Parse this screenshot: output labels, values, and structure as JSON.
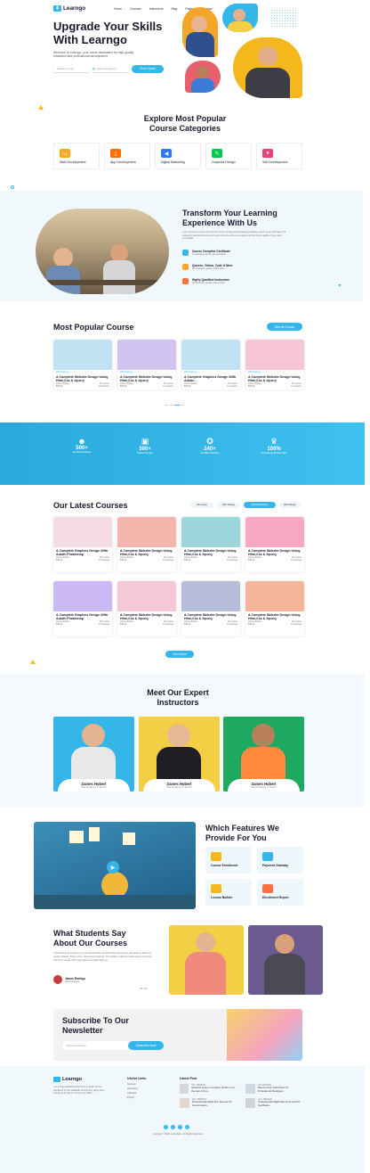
{
  "brand": {
    "name": "Learngo",
    "accent": "#35b6e8",
    "highlight": "#f9a825"
  },
  "nav": {
    "items": [
      "Home",
      "Courses",
      "Instructors",
      "Blog",
      "Pages",
      "Contact"
    ]
  },
  "hero": {
    "title_line1": "Upgrade Your Skills",
    "title_line2": "With Learngo",
    "subtitle": "Welcome to Learngo, your online destination for high-quality education and professional development",
    "search_placeholder": "Search course",
    "category_placeholder": "Select Category",
    "find_button": "Find Course"
  },
  "categories": {
    "title_line1": "Explore Most Popular",
    "title_line2": "Course Categories",
    "items": [
      {
        "label": "Web Development",
        "color": "#f9a825",
        "icon": "monitor-icon"
      },
      {
        "label": "App Development",
        "color": "#ff6d00",
        "icon": "phone-icon"
      },
      {
        "label": "Digital Marketing",
        "color": "#2979ff",
        "icon": "megaphone-icon"
      },
      {
        "label": "Graphics Design",
        "color": "#00c853",
        "icon": "pen-icon"
      },
      {
        "label": "Self Development",
        "color": "#ec407a",
        "icon": "person-icon"
      }
    ]
  },
  "transform": {
    "title_line1": "Transform Your Learning",
    "title_line2": "Experience With Us",
    "body": "Lorem ipsum is simply dummy text of the printing and typesetting industry. Lorem ipsum has been the industry's standard dummy text ever since the when an unknown printer took a galley of type and scrambled.",
    "features": [
      {
        "title": "Course Complete Certificate",
        "desc": "Completing course get certificate",
        "color": "#35b6e8"
      },
      {
        "title": "Quizzes, Videos, Code & More",
        "desc": "All Instructor quality online store",
        "color": "#f9a825"
      },
      {
        "title": "Highly Qualified Instructors",
        "desc": "All Instructor quality online store",
        "color": "#ff7043"
      }
    ]
  },
  "popular": {
    "title": "Most Popular Course",
    "see_all": "See All Course",
    "cards": [
      {
        "tag": "Web Design",
        "title": "A Complete Website Design Using Html,Css & Jquery",
        "author": "James Robert",
        "lessons": "30 Lesson",
        "price": "$35.00",
        "students": "26 students",
        "thumb": "#bfe3f3"
      },
      {
        "tag": "Web Design",
        "title": "A Complete Website Design Using Html,Css & Jquery",
        "author": "James Robert",
        "lessons": "30 Lesson",
        "price": "$35.00",
        "students": "11 students",
        "thumb": "#cfc3f0"
      },
      {
        "tag": "Web Design",
        "title": "A Complete Graphics Design With Adobe...",
        "author": "James Robert",
        "lessons": "30 Lesson",
        "price": "$35.00",
        "students": "11 students",
        "thumb": "#bfe3f3"
      },
      {
        "tag": "Web Design",
        "title": "A Complete Website Design Using Html,Css & Jquery",
        "author": "James Robert",
        "lessons": "30 Lesson",
        "price": "$35.00",
        "students": "11 students",
        "thumb": "#f7c6d6"
      }
    ]
  },
  "stats": [
    {
      "num": "500+",
      "label": "Enrolled Students",
      "icon": "students-icon"
    },
    {
      "num": "300+",
      "label": "Online Courses",
      "icon": "board-icon"
    },
    {
      "num": "240+",
      "label": "Certified Teachers",
      "icon": "certificate-icon"
    },
    {
      "num": "100%",
      "label": "Success & Comfort Rate",
      "icon": "trophy-icon"
    }
  ],
  "latest": {
    "title": "Our Latest Courses",
    "filters": [
      "All Course",
      "Web Design",
      "Digital Marketing",
      "Web Design"
    ],
    "active_filter": 2,
    "cards": [
      {
        "title": "A Complete Graphics Design With Adobe Photoshop",
        "author": "James Robert",
        "lessons": "30 Lesson",
        "price": "$35.00",
        "students": "20 students",
        "thumb": "#f5dbe4"
      },
      {
        "title": "A Complete Website Design Using Html,Css & Jquery",
        "author": "James Robert",
        "lessons": "30 Lesson",
        "price": "$35.00",
        "students": "11 students",
        "thumb": "#f2b6ad"
      },
      {
        "title": "A Complete Website Design Using Html,Css & Jquery",
        "author": "James Robert",
        "lessons": "30 Lesson",
        "price": "$35.00",
        "students": "11 students",
        "thumb": "#9cd5da"
      },
      {
        "title": "A Complete Website Design Using Html,Css & Jquery",
        "author": "James Robert",
        "lessons": "30 Lesson",
        "price": "$35.00",
        "students": "11 students",
        "thumb": "#f7a9c4"
      },
      {
        "title": "A Complete Graphics Design With Adobe Photoshop",
        "author": "James Robert",
        "lessons": "30 Lesson",
        "price": "$35.00",
        "students": "20 students",
        "thumb": "#cbb9f3"
      },
      {
        "title": "A Complete Website Design Using Html,Css & Jquery",
        "author": "James Robert",
        "lessons": "30 Lesson",
        "price": "$35.00",
        "students": "11 students",
        "thumb": "#f4c8d8"
      },
      {
        "title": "A Complete Website Design Using Html,Css & Jquery",
        "author": "James Robert",
        "lessons": "30 Lesson",
        "price": "$35.00",
        "students": "11 students",
        "thumb": "#b6bdd8"
      },
      {
        "title": "A Complete Website Design Using Html,Css & Jquery",
        "author": "James Robert",
        "lessons": "30 Lesson",
        "price": "$35.00",
        "students": "11 students",
        "thumb": "#f4b59a"
      }
    ],
    "view_more": "View More"
  },
  "instructors": {
    "title_line1": "Meet Our Expert",
    "title_line2": "Instructors",
    "items": [
      {
        "name": "Zames Hobert",
        "role": "Web Designer, IT Expert",
        "bg": "#35b6e8"
      },
      {
        "name": "Zames Hobert",
        "role": "Web Designer, IT Expert",
        "bg": "#f3cf45"
      },
      {
        "name": "Zames Hobert",
        "role": "Web Designer, IT Expert",
        "bg": "#1fa85f"
      }
    ]
  },
  "features": {
    "title_line1": "Which Features We",
    "title_line2": "Provide For You",
    "items": [
      {
        "label": "Course Enrollment",
        "icon": "enroll-icon"
      },
      {
        "label": "Payment Gateway",
        "icon": "payment-icon"
      },
      {
        "label": "Lesson Builder",
        "icon": "builder-icon"
      },
      {
        "label": "Enrollment Report",
        "icon": "report-icon"
      }
    ]
  },
  "testimonial": {
    "title_line1": "What Students Say",
    "title_line2": "About Our Courses",
    "quote": "I was looking to develop my professional skills, but didn't have the time or resources to attend in-person classes. That's when I discovered Learngo. The platform offered a wide range of courses that fit my needs, and I was able to complete them at",
    "name": "James Rodrigo",
    "role": "Web Designer",
    "pager": "01 / 03"
  },
  "newsletter": {
    "title_line1": "Subscribe To Our",
    "title_line2": "Newsletter",
    "placeholder": "Enter email here",
    "button": "Subscribe Now"
  },
  "footer": {
    "about": "It is a long established fact that a reader will be distracted by the readable content of a page when looking at its layout. Contact us offline.",
    "links_title": "Useful Links",
    "links": [
      "Courses",
      "Instructors",
      "Calendar",
      "Pricing"
    ],
    "posts_title": "Latest Post",
    "posts": [
      {
        "tag": "UX / DESIGN",
        "title": "Students enjoy a complete hands-on on the web of boo..."
      },
      {
        "tag": "UX / DESIGN",
        "title": "Step-by-step instructions for Professional Designers..."
      },
      {
        "tag": "UX / DESIGN",
        "title": "Professionals Might also become for Content team..."
      },
      {
        "tag": "UX / DESIGN",
        "title": "Professionals Might also know How To Get Better..."
      }
    ],
    "social": [
      "f",
      "t",
      "in",
      "y"
    ],
    "copyright": "Copyright ©2023 Codexlabs. All Rights Reserved"
  }
}
